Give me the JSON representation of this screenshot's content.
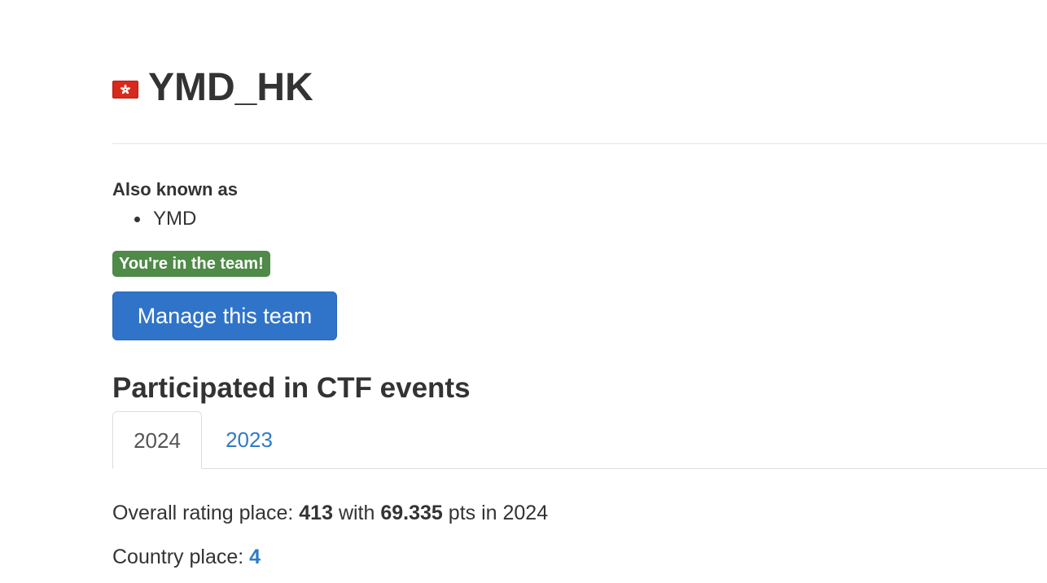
{
  "team": {
    "name": "YMD_HK",
    "flag_icon": "hong-kong-flag-icon"
  },
  "aliases": {
    "label": "Also known as",
    "items": [
      "YMD"
    ]
  },
  "membership_badge": "You're in the team!",
  "manage_button": "Manage this team",
  "events": {
    "title": "Participated in CTF events",
    "tabs": [
      {
        "label": "2024",
        "active": true
      },
      {
        "label": "2023",
        "active": false
      }
    ],
    "summary": {
      "overall_prefix": "Overall rating place:",
      "overall_place": "413",
      "with_word": "with",
      "points": "69.335",
      "pts_suffix": "pts in 2024",
      "country_prefix": "Country place:",
      "country_place": "4"
    }
  },
  "colors": {
    "badge_green": "#4f8a48",
    "button_blue": "#2f74c9",
    "link_blue": "#2f7bc4",
    "flag_red": "#d9291c"
  }
}
